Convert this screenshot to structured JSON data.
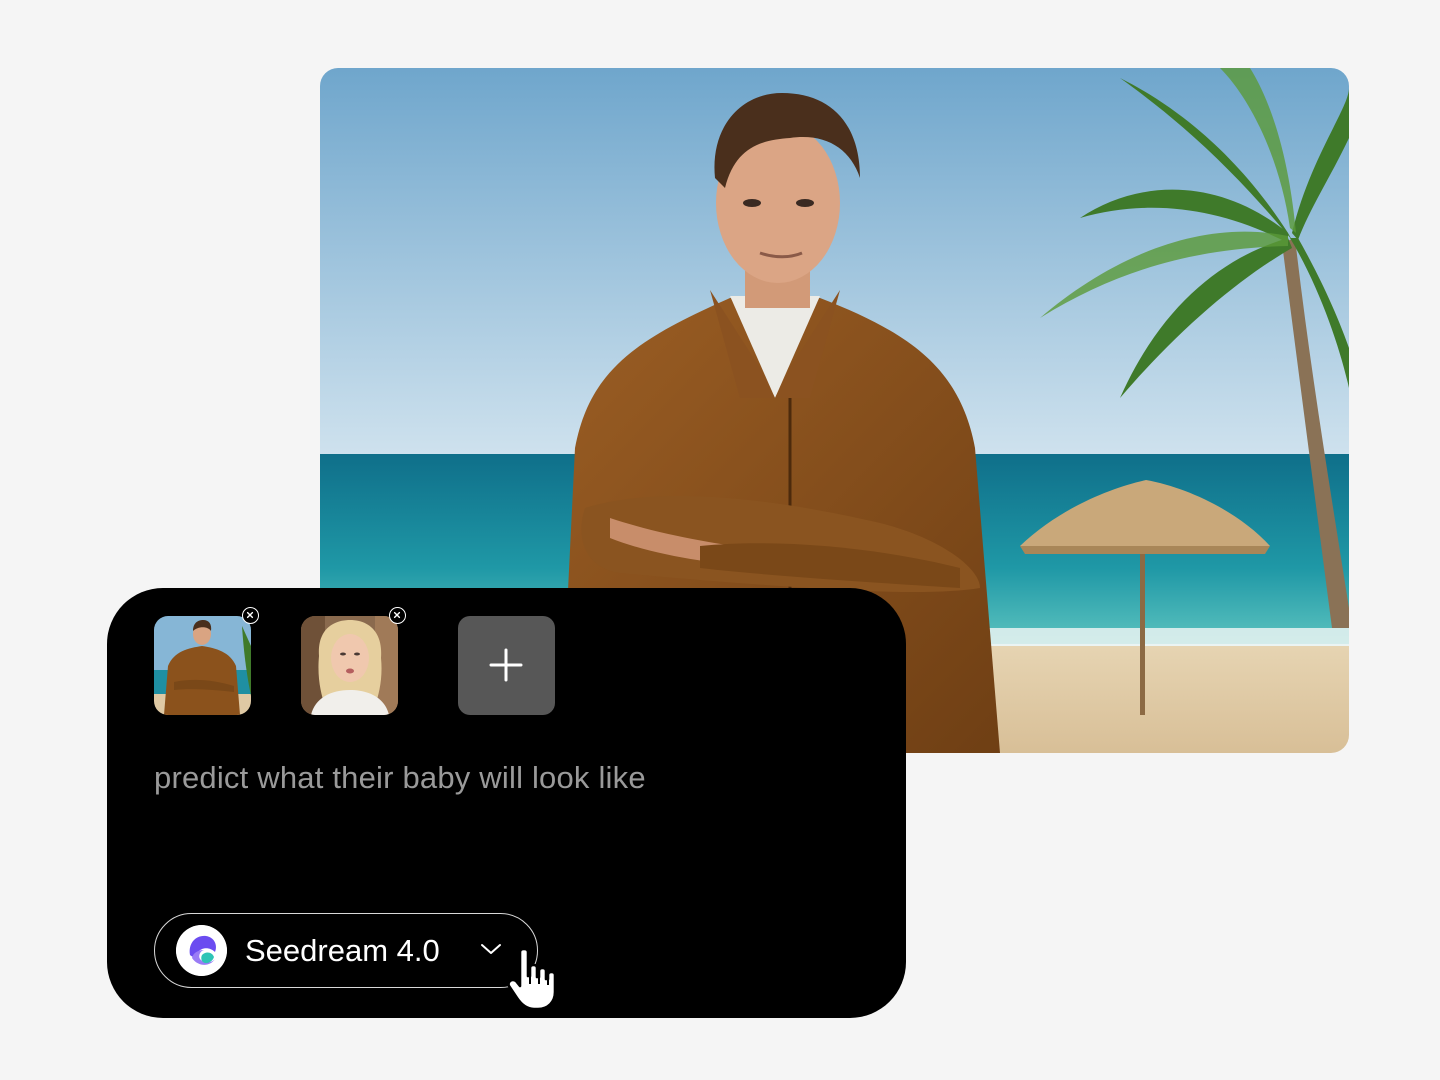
{
  "hero_image": {
    "icon": "generated-beach-portrait"
  },
  "composer": {
    "references": [
      {
        "icon": "man-photo-thumbnail",
        "remove_icon": "close-icon"
      },
      {
        "icon": "woman-photo-thumbnail",
        "remove_icon": "close-icon"
      }
    ],
    "add_icon": "plus-icon",
    "prompt": "predict what their baby will look like",
    "model": {
      "name": "Seedream 4.0",
      "logo_icon": "seedream-logo-icon",
      "dropdown_icon": "chevron-down-icon"
    }
  },
  "cursor_icon": "hand-pointer-icon",
  "colors": {
    "page_background": "#f5f5f5",
    "composer_background": "#000000",
    "prompt_text": "#9a9a9a",
    "model_text": "#ffffff",
    "add_button": "#575757",
    "brand_purple": "#6b4cf0",
    "brand_teal": "#2ec4b6"
  }
}
